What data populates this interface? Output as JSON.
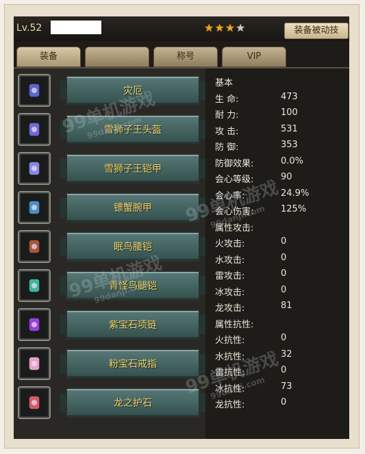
{
  "header": {
    "level": "Lv.52",
    "stars": [
      "gold",
      "gold",
      "gold",
      "grey"
    ],
    "passive_button": "装备被动技"
  },
  "tabs": [
    {
      "label": "装备",
      "active": true
    },
    {
      "label": "称号",
      "active": false
    },
    {
      "label": "VIP",
      "active": false
    }
  ],
  "equipment": [
    {
      "name": "灾厄",
      "icon": "bracer-icon",
      "color": "#5b66c9"
    },
    {
      "name": "雪狮子王头盔",
      "icon": "helmet-icon",
      "color": "#6f6ad4"
    },
    {
      "name": "雪狮子王铠甲",
      "icon": "chest-armor-icon",
      "color": "#8a86e6"
    },
    {
      "name": "镖蟹腕甲",
      "icon": "gauntlet-icon",
      "color": "#4a8ec2"
    },
    {
      "name": "眠鸟腰铠",
      "icon": "belt-icon",
      "color": "#a8553a"
    },
    {
      "name": "青怪鸟腿铠",
      "icon": "greaves-icon",
      "color": "#3fb49b"
    },
    {
      "name": "紫宝石项链",
      "icon": "necklace-icon",
      "color": "#9b3fd4"
    },
    {
      "name": "粉宝石戒指",
      "icon": "ring-icon",
      "color": "#e8a0c8"
    },
    {
      "name": "龙之护石",
      "icon": "talisman-icon",
      "color": "#d45a6a"
    }
  ],
  "stats": {
    "basic_heading": "基本",
    "basic": [
      {
        "label": "生 命:",
        "value": "473"
      },
      {
        "label": "耐 力:",
        "value": "100"
      },
      {
        "label": "攻 击:",
        "value": "531"
      },
      {
        "label": "防 御:",
        "value": "353"
      },
      {
        "label": "防御效果:",
        "value": "0.0%"
      },
      {
        "label": "会心等级:",
        "value": "90"
      },
      {
        "label": "会心率:",
        "value": "24.9%"
      },
      {
        "label": "会心伤害:",
        "value": "125%"
      }
    ],
    "attack_heading": "属性攻击:",
    "attack": [
      {
        "label": "火攻击:",
        "value": "0"
      },
      {
        "label": "水攻击:",
        "value": "0"
      },
      {
        "label": "雷攻击:",
        "value": "0"
      },
      {
        "label": "冰攻击:",
        "value": "0"
      },
      {
        "label": "龙攻击:",
        "value": "81"
      }
    ],
    "resist_heading": "属性抗性:",
    "resist": [
      {
        "label": "火抗性:",
        "value": "0"
      },
      {
        "label": "水抗性:",
        "value": "32"
      },
      {
        "label": "雷抗性:",
        "value": "0"
      },
      {
        "label": "冰抗性:",
        "value": "73"
      },
      {
        "label": "龙抗性:",
        "value": "0"
      }
    ]
  },
  "watermark": {
    "big": "99单机游戏",
    "small": "99danji.com"
  }
}
